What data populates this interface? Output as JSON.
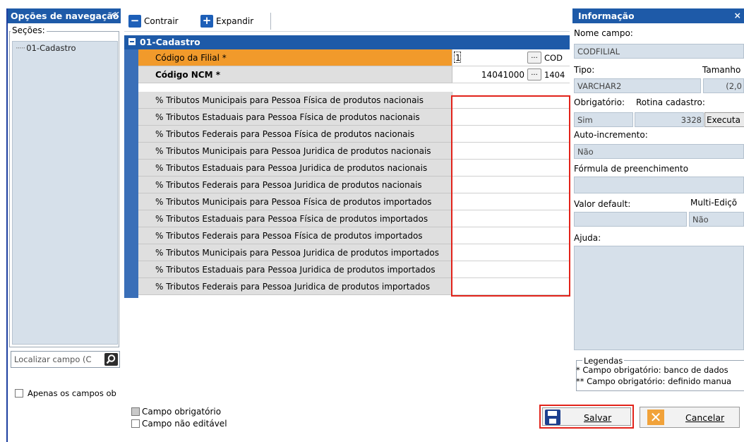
{
  "left_panel": {
    "title": "Opções de navegação",
    "collapse_glyph": "≪",
    "sections_label": "Seções:",
    "tree_items": [
      "01-Cadastro"
    ],
    "search_placeholder": "Localizar campo (C",
    "only_fields_label": "Apenas os campos ob"
  },
  "toolbar": {
    "collapse_label": "Contrair",
    "expand_label": "Expandir"
  },
  "grid": {
    "section_title": "01-Cadastro",
    "rows": [
      {
        "label": "Código da Filial *",
        "value": "1",
        "trail": "COD"
      },
      {
        "label": "Código NCM *",
        "value": "14041000",
        "trail": "1404"
      },
      {
        "label": "% Tributos Municipais para Pessoa Física de produtos nacionais",
        "value": ""
      },
      {
        "label": "% Tributos Estaduais para Pessoa Física de produtos nacionais",
        "value": ""
      },
      {
        "label": "% Tributos Federais para Pessoa Física de produtos nacionais",
        "value": ""
      },
      {
        "label": "% Tributos Municipais para Pessoa Juridica de produtos nacionais",
        "value": ""
      },
      {
        "label": "% Tributos Estaduais para Pessoa Juridica de produtos nacionais",
        "value": ""
      },
      {
        "label": "% Tributos Federais para Pessoa Juridica de produtos nacionais",
        "value": ""
      },
      {
        "label": "% Tributos Municipais para Pessoa Física de produtos importados",
        "value": ""
      },
      {
        "label": "% Tributos Estaduais para Pessoa Física de produtos importados",
        "value": ""
      },
      {
        "label": "% Tributos Federais para Pessoa Física de produtos importados",
        "value": ""
      },
      {
        "label": "% Tributos Municipais para Pessoa Juridica de produtos importados",
        "value": ""
      },
      {
        "label": "% Tributos Estaduais para Pessoa Juridica de produtos importados",
        "value": ""
      },
      {
        "label": "% Tributos Federais para Pessoa Juridica de produtos importados",
        "value": ""
      }
    ],
    "ellipsis": "..."
  },
  "info_panel": {
    "title": "Informação",
    "close_glyph": "×",
    "field_name_label": "Nome campo:",
    "field_name_value": "CODFILIAL",
    "type_label": "Tipo:",
    "type_value": "VARCHAR2",
    "size_label": "Tamanho",
    "size_value": "(2,0",
    "required_label": "Obrigatório:",
    "required_value": "Sim",
    "routine_label": "Rotina cadastro:",
    "routine_value": "3328",
    "execute_label": "Executa",
    "autoinc_label": "Auto-incremento:",
    "autoinc_value": "Não",
    "formula_label": "Fórmula de preenchimento",
    "formula_value": "",
    "default_label": "Valor default:",
    "default_value": "",
    "multi_label": "Multi-Ediçõ",
    "multi_value": "Não",
    "help_label": "Ajuda:",
    "help_value": "",
    "legend_title": "Legendas",
    "legend_line1": "* Campo obrigatório: banco de dados",
    "legend_line2": "** Campo obrigatório: definido manua"
  },
  "bottom": {
    "legend_required": "Campo obrigatório",
    "legend_not_editable": "Campo não editável",
    "save_label": "Salvar",
    "cancel_label": "Cancelar"
  },
  "colors": {
    "title_blue": "#1e5aa8",
    "highlight_orange": "#f19a2b",
    "annotation_red": "#e2231a",
    "readonly_field": "#d6e0ea"
  }
}
